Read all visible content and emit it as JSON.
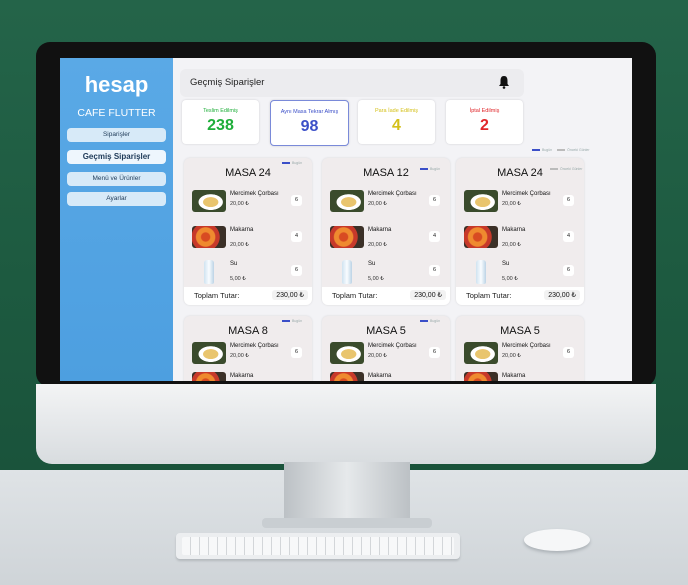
{
  "sidebar": {
    "brand": "hesap",
    "subtitle": "CAFE FLUTTER",
    "items": [
      {
        "label": "Siparişler"
      },
      {
        "label": "Geçmiş Siparişler"
      },
      {
        "label": "Menü ve Ürünler"
      },
      {
        "label": "Ayarlar"
      }
    ]
  },
  "header": {
    "title": "Geçmiş Siparişler",
    "bell_icon": "bell-icon"
  },
  "stats": [
    {
      "label": "Teslim Edilmiş",
      "value": "238",
      "color": "#1fae3a"
    },
    {
      "label": "Aynı Masa Tekrar Almış",
      "value": "98",
      "color": "#3b4fc8"
    },
    {
      "label": "Para İade Edilmiş",
      "value": "4",
      "color": "#d4c019"
    },
    {
      "label": "İptal Edilmiş",
      "value": "2",
      "color": "#e0262a"
    }
  ],
  "legend": {
    "primary": "Bugün",
    "secondary": "Önceki Günler"
  },
  "items_common": {
    "soup": {
      "name": "Mercimek Çorbası",
      "price": "20,00 ₺",
      "qty": "6"
    },
    "pasta": {
      "name": "Makarna",
      "price": "20,00 ₺",
      "qty": "4"
    },
    "water": {
      "name": "Su",
      "price": "5,00 ₺",
      "qty": "6"
    }
  },
  "cards": [
    {
      "title": "MASA 24",
      "total_label": "Toplam Tutar:",
      "total": "230,00 ₺"
    },
    {
      "title": "MASA 12",
      "total_label": "Toplam Tutar:",
      "total": "230,00 ₺"
    },
    {
      "title": "MASA 24",
      "total_label": "Toplam Tutar:",
      "total": "230,00 ₺"
    },
    {
      "title": "MASA 8"
    },
    {
      "title": "MASA 5"
    },
    {
      "title": "MASA 5"
    }
  ]
}
